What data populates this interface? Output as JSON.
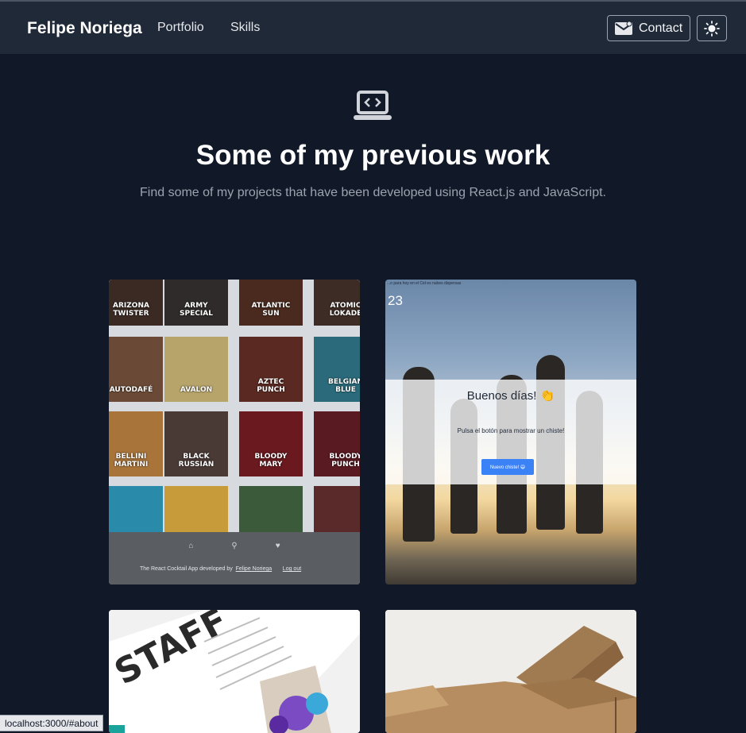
{
  "navbar": {
    "brand": "Felipe Noriega",
    "links": [
      "Portfolio",
      "Skills"
    ],
    "contact_label": "Contact"
  },
  "hero": {
    "title": "Some of my previous work",
    "subtitle": "Find some of my projects that have been developed using React.js and JavaScript."
  },
  "projects": [
    {
      "cocktails": [
        "ARIZONA\nTWISTER",
        "ARMY\nSPECIAL",
        "ATLANTIC\nSUN",
        "ATOMIC\nLOKADE",
        "AUTODAFÉ",
        "AVALON",
        "AZTEC\nPUNCH",
        "BELGIAN\nBLUE",
        "BELLINI\nMARTINI",
        "BLACK\nRUSSIAN",
        "BLOODY\nMARY",
        "BLOODY\nPUNCH"
      ],
      "footer_credit": "The React Cocktail App developed by",
      "footer_author": "Felipe Noriega",
      "footer_logout": "Log out"
    },
    {
      "top_text": "...o para hoy en el Cid es nubes dispersas",
      "temperature": "23",
      "greeting": "Buenos días! 👏",
      "prompt": "Pulsa el botón para mostrar un chiste!",
      "button": "Nuevo chiste! 😄"
    }
  ],
  "status_bar": "localhost:3000/#about",
  "colors": {
    "background": "#111827",
    "navbar": "#1f2937",
    "accent": "#3b82f6"
  }
}
